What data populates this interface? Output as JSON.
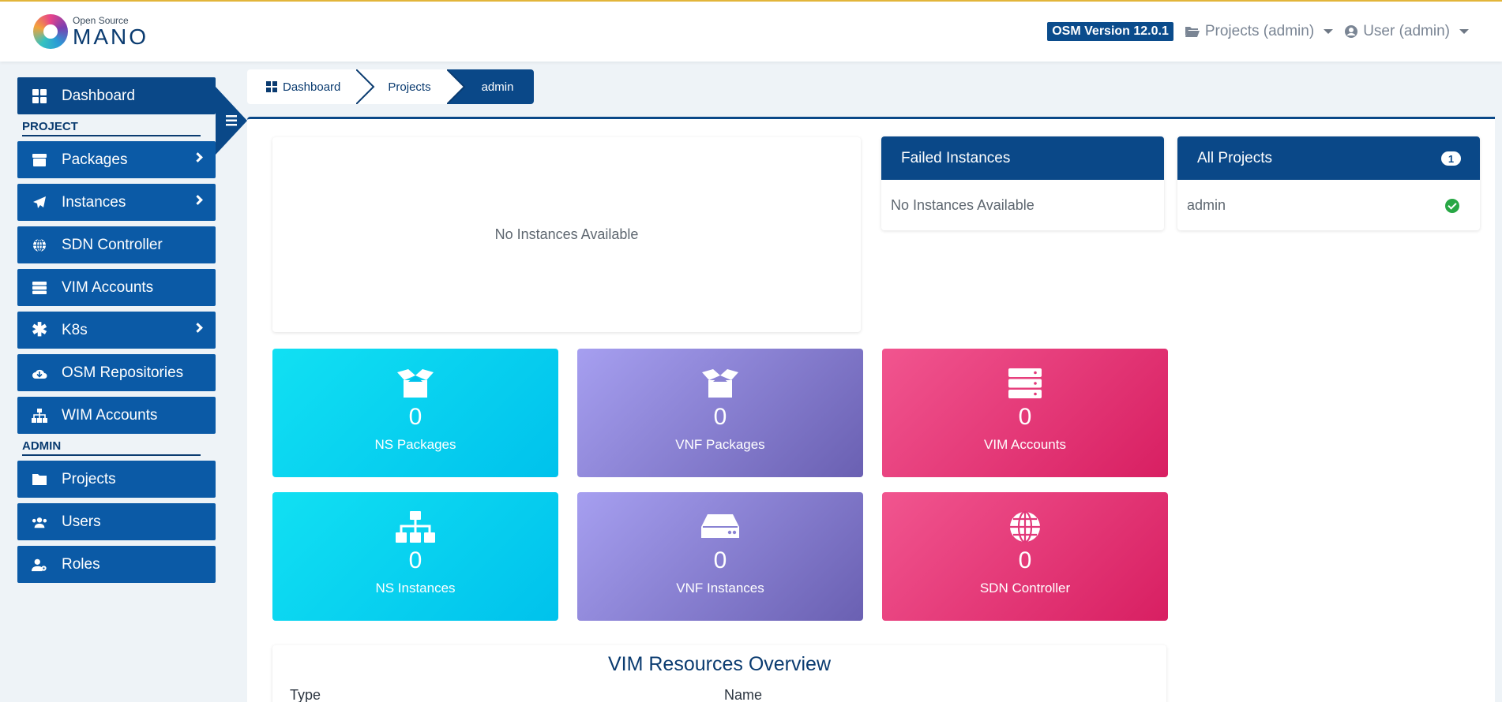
{
  "header": {
    "logo_small": "Open Source",
    "logo_big": "MANO",
    "version": "OSM Version 12.0.1",
    "projects_menu": "Projects (admin)",
    "user_menu": "User (admin)"
  },
  "sidebar": {
    "dashboard": "Dashboard",
    "project_section": "PROJECT",
    "admin_section": "ADMIN",
    "project_items": [
      {
        "label": "Packages",
        "icon": "box-icon",
        "has_submenu": true
      },
      {
        "label": "Instances",
        "icon": "paper-plane-icon",
        "has_submenu": true
      },
      {
        "label": "SDN Controller",
        "icon": "globe-icon",
        "has_submenu": false
      },
      {
        "label": "VIM Accounts",
        "icon": "server-icon",
        "has_submenu": false
      },
      {
        "label": "K8s",
        "icon": "asterisk-icon",
        "has_submenu": true
      },
      {
        "label": "OSM Repositories",
        "icon": "cloud-download-icon",
        "has_submenu": false
      },
      {
        "label": "WIM Accounts",
        "icon": "sitemap-icon",
        "has_submenu": false
      }
    ],
    "admin_items": [
      {
        "label": "Projects",
        "icon": "folder-icon"
      },
      {
        "label": "Users",
        "icon": "users-icon"
      },
      {
        "label": "Roles",
        "icon": "user-cog-icon"
      }
    ]
  },
  "breadcrumb": [
    "Dashboard",
    "Projects",
    "admin"
  ],
  "instances_chart": {
    "empty_text": "No Instances Available"
  },
  "failed_instances": {
    "title": "Failed Instances",
    "empty_text": "No Instances Available"
  },
  "all_projects": {
    "title": "All Projects",
    "count": "1",
    "items": [
      "admin"
    ]
  },
  "stats": [
    {
      "value": "0",
      "label": "NS Packages",
      "icon": "box-open-icon",
      "color": "cyan"
    },
    {
      "value": "0",
      "label": "VNF Packages",
      "icon": "box-open-icon",
      "color": "purple"
    },
    {
      "value": "0",
      "label": "VIM Accounts",
      "icon": "server-icon",
      "color": "pink"
    },
    {
      "value": "0",
      "label": "NS Instances",
      "icon": "sitemap-icon",
      "color": "cyan"
    },
    {
      "value": "0",
      "label": "VNF Instances",
      "icon": "hdd-icon",
      "color": "purple"
    },
    {
      "value": "0",
      "label": "SDN Controller",
      "icon": "globe-icon",
      "color": "pink"
    }
  ],
  "vim_overview": {
    "title": "VIM Resources Overview",
    "columns": [
      "Type",
      "Name"
    ]
  },
  "colors": {
    "primary": "#0a4888",
    "nav": "#0b5aa6",
    "accent_top": "#e2b53a",
    "success": "#28a745"
  }
}
